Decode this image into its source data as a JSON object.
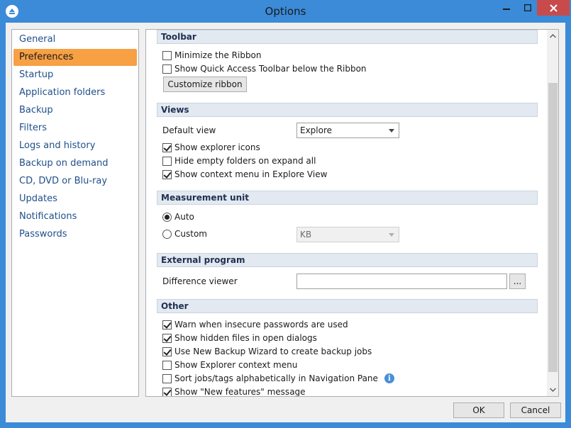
{
  "window": {
    "title": "Options"
  },
  "sidebar": {
    "items": [
      {
        "label": "General",
        "active": false
      },
      {
        "label": "Preferences",
        "active": true
      },
      {
        "label": "Startup",
        "active": false
      },
      {
        "label": "Application folders",
        "active": false
      },
      {
        "label": "Backup",
        "active": false
      },
      {
        "label": "Filters",
        "active": false
      },
      {
        "label": "Logs and history",
        "active": false
      },
      {
        "label": "Backup on demand",
        "active": false
      },
      {
        "label": "CD, DVD or Blu-ray",
        "active": false
      },
      {
        "label": "Updates",
        "active": false
      },
      {
        "label": "Notifications",
        "active": false
      },
      {
        "label": "Passwords",
        "active": false
      }
    ]
  },
  "toolbar": {
    "header": "Toolbar",
    "minimize_ribbon": {
      "label": "Minimize the Ribbon",
      "checked": false
    },
    "quick_access_below": {
      "label": "Show Quick Access Toolbar below the Ribbon",
      "checked": false
    },
    "customize_button": "Customize ribbon"
  },
  "views": {
    "header": "Views",
    "default_view_label": "Default view",
    "default_view_value": "Explore",
    "show_explorer_icons": {
      "label": "Show explorer icons",
      "checked": true
    },
    "hide_empty_folders": {
      "label": "Hide empty folders on expand all",
      "checked": false
    },
    "show_context_menu": {
      "label": "Show context menu in Explore View",
      "checked": true
    }
  },
  "measurement": {
    "header": "Measurement unit",
    "auto": {
      "label": "Auto",
      "checked": true
    },
    "custom": {
      "label": "Custom",
      "checked": false
    },
    "unit_value": "KB"
  },
  "external": {
    "header": "External program",
    "diff_viewer_label": "Difference viewer",
    "diff_viewer_value": "",
    "browse_label": "..."
  },
  "other": {
    "header": "Other",
    "warn_insecure": {
      "label": "Warn when insecure passwords are used",
      "checked": true
    },
    "show_hidden": {
      "label": "Show hidden files in open dialogs",
      "checked": true
    },
    "use_wizard": {
      "label": "Use New Backup Wizard to create backup jobs",
      "checked": true
    },
    "explorer_context": {
      "label": "Show Explorer context menu",
      "checked": false
    },
    "sort_alpha": {
      "label": "Sort jobs/tags alphabetically in Navigation Pane",
      "checked": false
    },
    "new_features": {
      "label": "Show \"New features\" message",
      "checked": true
    }
  },
  "footer": {
    "ok": "OK",
    "cancel": "Cancel"
  },
  "colors": {
    "titlebar": "#3b8bd8",
    "accent": "#f7a044",
    "close": "#c74b4b"
  }
}
